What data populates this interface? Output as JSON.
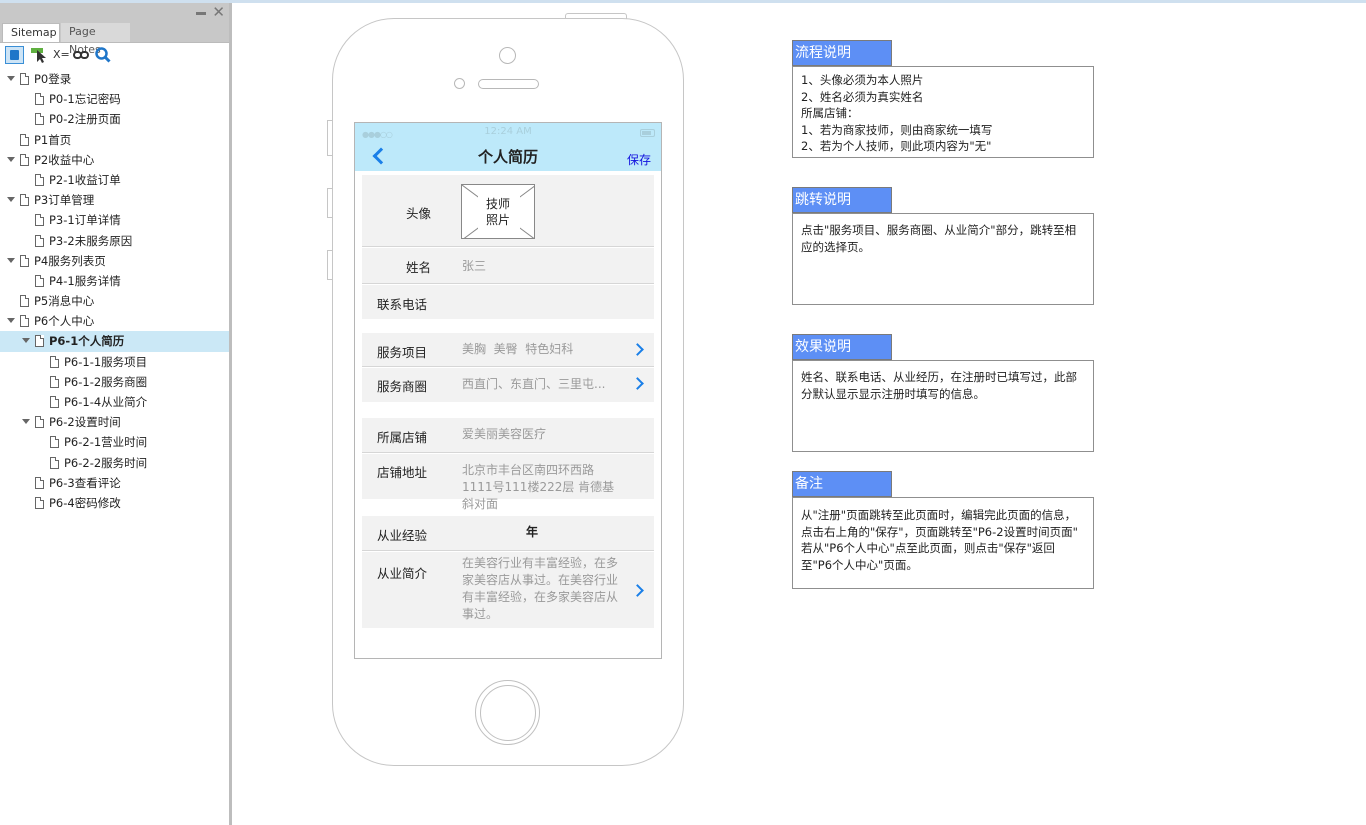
{
  "sidebar": {
    "tabs": [
      {
        "label": "Sitemap",
        "active": true
      },
      {
        "label": "Page Notes",
        "active": false
      }
    ],
    "toolbar": {
      "icons": [
        "pages-icon",
        "pointer-icon",
        "variables-icon",
        "link-icon",
        "search-icon"
      ],
      "variables_label": "X=",
      "link_label": "GO"
    },
    "tree": [
      {
        "label": "P0登录",
        "level": 0,
        "expanded": true
      },
      {
        "label": "P0-1忘记密码",
        "level": 1
      },
      {
        "label": "P0-2注册页面",
        "level": 1
      },
      {
        "label": "P1首页",
        "level": 0
      },
      {
        "label": "P2收益中心",
        "level": 0,
        "expanded": true
      },
      {
        "label": "P2-1收益订单",
        "level": 1
      },
      {
        "label": "P3订单管理",
        "level": 0,
        "expanded": true
      },
      {
        "label": "P3-1订单详情",
        "level": 1
      },
      {
        "label": "P3-2未服务原因",
        "level": 1
      },
      {
        "label": "P4服务列表页",
        "level": 0,
        "expanded": true
      },
      {
        "label": "P4-1服务详情",
        "level": 1
      },
      {
        "label": "P5消息中心",
        "level": 0
      },
      {
        "label": "P6个人中心",
        "level": 0,
        "expanded": true
      },
      {
        "label": "P6-1个人简历",
        "level": 1,
        "expanded": true,
        "selected": true
      },
      {
        "label": "P6-1-1服务项目",
        "level": 2
      },
      {
        "label": "P6-1-2服务商圈",
        "level": 2
      },
      {
        "label": "P6-1-4从业简介",
        "level": 2
      },
      {
        "label": "P6-2设置时间",
        "level": 1,
        "expanded": true
      },
      {
        "label": "P6-2-1营业时间",
        "level": 2
      },
      {
        "label": "P6-2-2服务时间",
        "level": 2
      },
      {
        "label": "P6-3查看评论",
        "level": 1
      },
      {
        "label": "P6-4密码修改",
        "level": 1
      }
    ]
  },
  "phone": {
    "status": {
      "signal": "●●●○○",
      "time": "12:24 AM"
    },
    "nav": {
      "title": "个人简历",
      "save_label": "保存"
    },
    "avatar": {
      "label": "头像",
      "placeholder": "技师\n照片"
    },
    "name": {
      "label": "姓名",
      "value": "张三"
    },
    "phone_field": {
      "label": "联系电话",
      "value": ""
    },
    "service_items": {
      "label": "服务项目",
      "value": "美胸  美臀  特色妇科"
    },
    "service_area": {
      "label": "服务商圈",
      "value": "西直门、东直门、三里屯..."
    },
    "shop": {
      "label": "所属店铺",
      "value": "爱美丽美容医疗"
    },
    "shop_address": {
      "label": "店铺地址",
      "value": "北京市丰台区南四环西路1111号111楼222层 肯德基斜对面"
    },
    "experience": {
      "label": "从业经验",
      "value": "年"
    },
    "intro": {
      "label": "从业简介",
      "value": "在美容行业有丰富经验，在多家美容店从事过。在美容行业有丰富经验，在多家美容店从事过。"
    }
  },
  "notes": [
    {
      "title": "流程说明",
      "body": "1、头像必须为本人照片\n2、姓名必须为真实姓名\n所属店铺：\n1、若为商家技师，则由商家统一填写\n2、若为个人技师，则此项内容为\"无\""
    },
    {
      "title": "跳转说明",
      "body": "点击\"服务项目、服务商圈、从业简介\"部分，跳转至相应的选择页。"
    },
    {
      "title": "效果说明",
      "body": "姓名、联系电话、从业经历，在注册时已填写过，此部分默认显示显示注册时填写的信息。"
    },
    {
      "title": "备注",
      "body": "从\"注册\"页面跳转至此页面时，编辑完此页面的信息，点击右上角的\"保存\"，页面跳转至\"P6-2设置时间页面\"\n若从\"P6个人中心\"点至此页面，则点击\"保存\"返回至\"P6个人中心\"页面。"
    }
  ]
}
